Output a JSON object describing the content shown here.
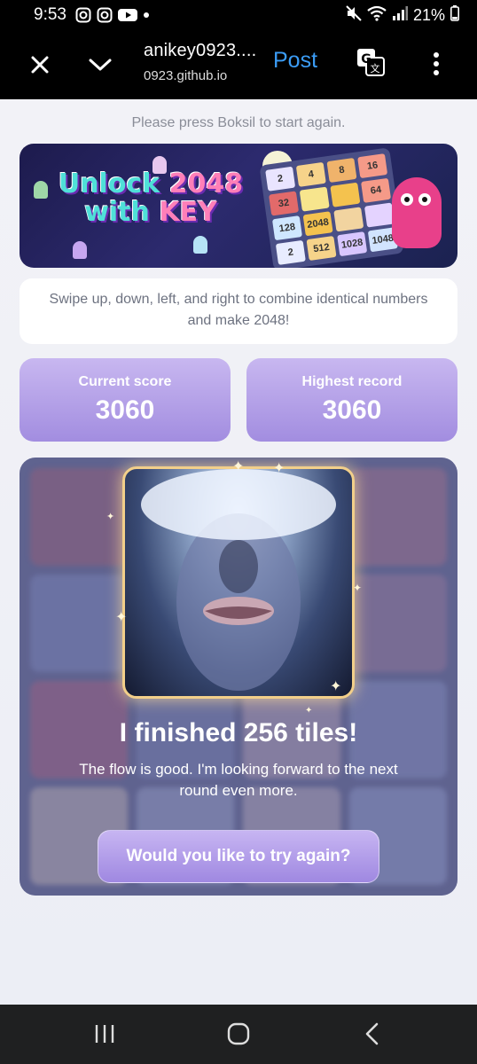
{
  "status_bar": {
    "time": "9:53",
    "battery": "21%",
    "icons": [
      "instagram-icon",
      "instagram-icon",
      "youtube-icon",
      "dot-icon",
      "mute-icon",
      "wifi-icon",
      "signal-icon",
      "battery-icon"
    ]
  },
  "app_bar": {
    "title": "anikey0923....",
    "domain": "0923.github.io",
    "post_label": "Post",
    "icons": [
      "close-icon",
      "chevron-down-icon",
      "translate-icon",
      "more-vert-icon"
    ]
  },
  "page": {
    "restart_note": "Please press Boksil to start again.",
    "banner": {
      "line1_a": "Unlock",
      "line1_b": "2048",
      "line2_a": "with",
      "line2_b": "KEY",
      "tiles": [
        "2",
        "4",
        "8",
        "16",
        "32",
        "",
        "",
        "64",
        "128",
        "2048",
        "",
        "",
        "2",
        "512",
        "1028",
        "1048"
      ]
    },
    "instructions": "Swipe up, down, left, and right to combine identical numbers and make 2048!",
    "scores": {
      "current_label": "Current score",
      "current_value": "3060",
      "high_label": "Highest record",
      "high_value": "3060"
    },
    "result": {
      "title": "I finished 256 tiles!",
      "subtitle": "The flow is good. I'm looking forward to the next round even more.",
      "retry_label": "Would you like to try again?"
    }
  },
  "colors": {
    "accent_blue": "#3b9cf5",
    "score_card_top": "#c8b7f0",
    "score_card_bottom": "#a28de0",
    "panel_bg": "#6c6f9a",
    "frame_gold": "#f2cf8a"
  }
}
